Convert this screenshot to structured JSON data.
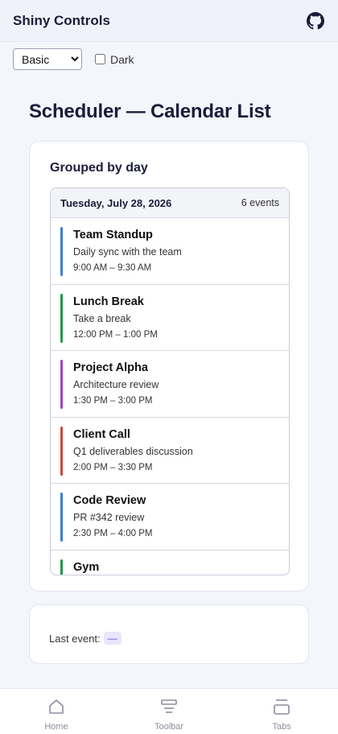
{
  "app": {
    "title": "Shiny Controls"
  },
  "controls": {
    "theme_select": {
      "value": "Basic",
      "options": [
        "Basic"
      ]
    },
    "dark_label": "Dark",
    "dark_checked": false
  },
  "page": {
    "heading": "Scheduler — Calendar List"
  },
  "scheduler": {
    "card_title": "Grouped by day",
    "day": {
      "label": "Tuesday, July 28, 2026",
      "count": "6 events"
    },
    "events": [
      {
        "title": "Team Standup",
        "description": "Daily sync with the team",
        "time": "9:00 AM – 9:30 AM",
        "color": "#3b7fe0"
      },
      {
        "title": "Lunch Break",
        "description": "Take a break",
        "time": "12:00 PM – 1:00 PM",
        "color": "#1f9a4b"
      },
      {
        "title": "Project Alpha",
        "description": "Architecture review",
        "time": "1:30 PM – 3:00 PM",
        "color": "#a43fc6"
      },
      {
        "title": "Client Call",
        "description": "Q1 deliverables discussion",
        "time": "2:00 PM – 3:30 PM",
        "color": "#d2443a"
      },
      {
        "title": "Code Review",
        "description": "PR #342 review",
        "time": "2:30 PM – 4:00 PM",
        "color": "#3b7fe0"
      },
      {
        "title": "Gym",
        "description": "",
        "time": "",
        "color": "#1f9a4b"
      }
    ]
  },
  "status": {
    "last_event_label": "Last event:",
    "last_event_value": "—"
  },
  "nav": [
    {
      "label": "Home",
      "icon": "home-icon"
    },
    {
      "label": "Toolbar",
      "icon": "toolbar-icon"
    },
    {
      "label": "Tabs",
      "icon": "tabs-icon"
    }
  ],
  "colors": {
    "accent": "#5b4fcf",
    "background": "#f4f6fc"
  }
}
